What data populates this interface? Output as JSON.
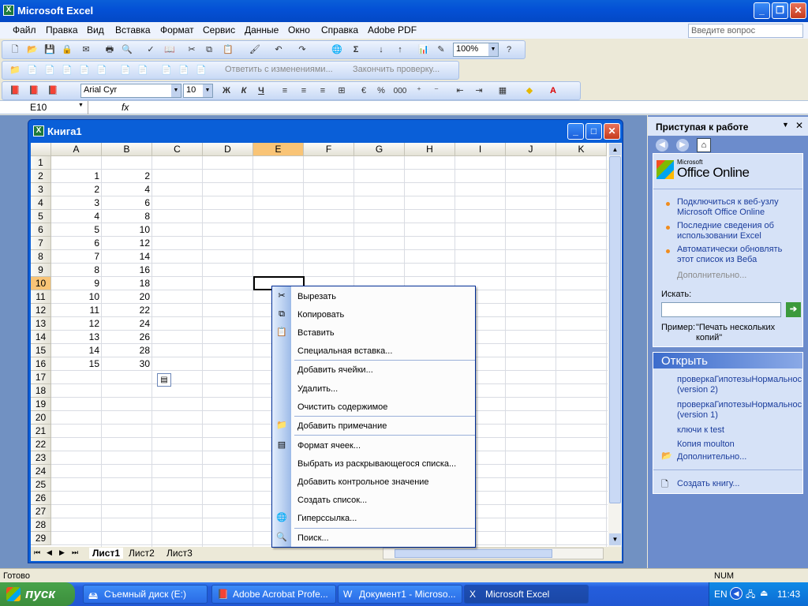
{
  "app": {
    "title": "Microsoft Excel"
  },
  "menu": {
    "items": [
      "Файл",
      "Правка",
      "Вид",
      "Вставка",
      "Формат",
      "Сервис",
      "Данные",
      "Окно",
      "Справка",
      "Adobe PDF"
    ],
    "ask_placeholder": "Введите вопрос"
  },
  "toolbar": {
    "zoom": "100%",
    "review_label": "Ответить с изменениями...",
    "end_review_label": "Закончить проверку...",
    "font_name": "Arial Cyr",
    "font_size": "10",
    "bold": "Ж",
    "italic": "К",
    "underline": "Ч",
    "percent": "%",
    "thousands": "000"
  },
  "formula_bar": {
    "name_box": "E10",
    "fx": "fx",
    "content": ""
  },
  "workbook": {
    "title": "Книга1",
    "columns": [
      "A",
      "B",
      "C",
      "D",
      "E",
      "F",
      "G",
      "H",
      "I",
      "J",
      "K"
    ],
    "selected_column": "E",
    "selected_row": "10",
    "rows": [
      "1",
      "2",
      "3",
      "4",
      "5",
      "6",
      "7",
      "8",
      "9",
      "10",
      "11",
      "12",
      "13",
      "14",
      "15",
      "16",
      "17",
      "18",
      "19",
      "20",
      "21",
      "22",
      "23",
      "24",
      "25",
      "26",
      "27",
      "28",
      "29"
    ],
    "col_a": [
      "",
      "1",
      "2",
      "3",
      "4",
      "5",
      "6",
      "7",
      "8",
      "9",
      "10",
      "11",
      "12",
      "13",
      "14",
      "15"
    ],
    "col_b": [
      "",
      "2",
      "4",
      "6",
      "8",
      "10",
      "12",
      "14",
      "16",
      "18",
      "20",
      "22",
      "24",
      "26",
      "28",
      "30"
    ],
    "sheets": [
      "Лист1",
      "Лист2",
      "Лист3"
    ]
  },
  "context_menu": {
    "items": [
      {
        "label": "Вырезать",
        "icon": "scissors-icon"
      },
      {
        "label": "Копировать",
        "icon": "copy-icon"
      },
      {
        "label": "Вставить",
        "icon": "paste-icon"
      },
      {
        "label": "Специальная вставка...",
        "icon": ""
      },
      {
        "label": "Добавить ячейки...",
        "icon": ""
      },
      {
        "label": "Удалить...",
        "icon": ""
      },
      {
        "label": "Очистить содержимое",
        "icon": ""
      },
      {
        "label": "Добавить примечание",
        "icon": "comment-icon"
      },
      {
        "label": "Формат ячеек...",
        "icon": "format-cells-icon"
      },
      {
        "label": "Выбрать из раскрывающегося списка...",
        "icon": ""
      },
      {
        "label": "Добавить контрольное значение",
        "icon": ""
      },
      {
        "label": "Создать список...",
        "icon": ""
      },
      {
        "label": "Гиперссылка...",
        "icon": "hyperlink-icon"
      },
      {
        "label": "Поиск...",
        "icon": "search-icon"
      }
    ]
  },
  "task_pane": {
    "title": "Приступая к работе",
    "logo_small": "Microsoft",
    "logo": "Office Online",
    "links": [
      "Подключиться к веб-узлу Microsoft Office Online",
      "Последние сведения об использовании Excel",
      "Автоматически обновлять этот список из Веба"
    ],
    "more": "Дополнительно...",
    "search_label": "Искать:",
    "example_label": "Пример:",
    "example_text": "\"Печать нескольких копий\"",
    "open_header": "Открыть",
    "files": [
      "проверкаГипотезыНормальнос (version 2)",
      "проверкаГипотезыНормальнос (version 1)",
      "ключи к test",
      "Копия moulton"
    ],
    "open_more": "Дополнительно...",
    "create": "Создать книгу..."
  },
  "status": {
    "left": "Готово",
    "num": "NUM"
  },
  "taskbar": {
    "start": "пуск",
    "buttons": [
      "Съемный диск (E:)",
      "Adobe Acrobat Profe...",
      "Документ1 - Microso...",
      "Microsoft Excel"
    ],
    "lang": "EN",
    "time": "11:43"
  }
}
